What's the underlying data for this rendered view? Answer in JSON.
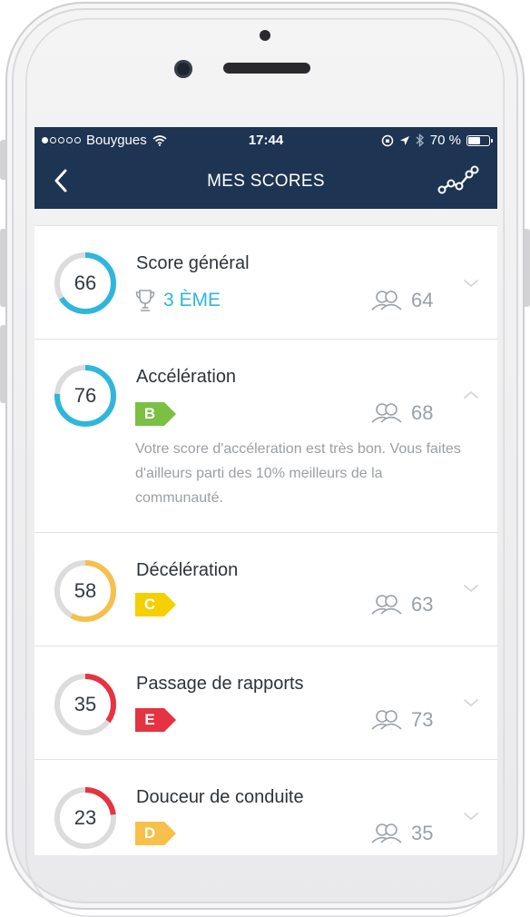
{
  "statusbar": {
    "carrier": "Bouygues",
    "time": "17:44",
    "battery_text": "70 %",
    "battery_level": 0.7,
    "signal_bars_filled": 1,
    "signal_bars_total": 5
  },
  "navbar": {
    "title": "MES SCORES",
    "back_icon": "chevron-left-icon",
    "action_icon": "line-chart-icon"
  },
  "colors": {
    "navy": "#1d3452",
    "blue": "#2fb6dd",
    "green": "#7bc043",
    "yellow": "#f4d000",
    "orange": "#f7c04a",
    "red": "#e63341",
    "gauge_track": "#dcdcdc"
  },
  "scores": [
    {
      "title": "Score général",
      "value": "66",
      "rank": "3 ÈME",
      "rank_icon": "trophy-icon",
      "community": "64",
      "expanded": false
    },
    {
      "title": "Accélération",
      "value": "76",
      "grade": "B",
      "community": "68",
      "expanded": true,
      "description": "Votre score d'accéleration est très bon. Vous faites d'ailleurs parti des 10% meilleurs de la communauté."
    },
    {
      "title": "Décélération",
      "value": "58",
      "grade": "C",
      "community": "63",
      "expanded": false
    },
    {
      "title": "Passage de rapports",
      "value": "35",
      "grade": "E",
      "community": "73",
      "expanded": false
    },
    {
      "title": "Douceur de conduite",
      "value": "23",
      "grade": "D",
      "community": "35",
      "expanded": false
    }
  ]
}
